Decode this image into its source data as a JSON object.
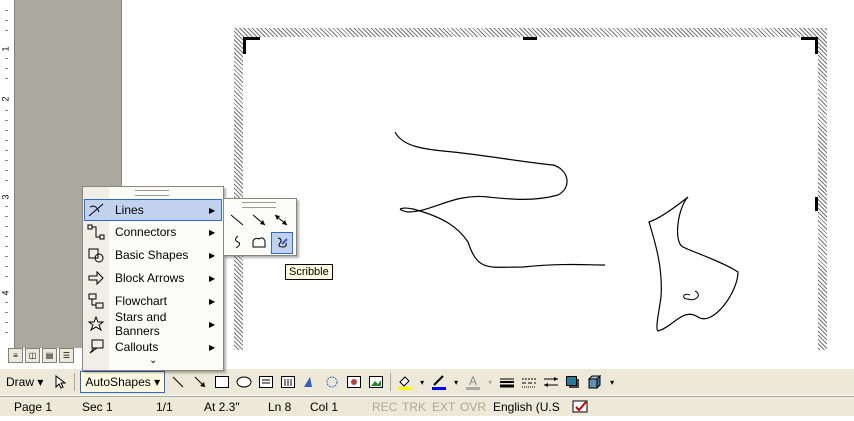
{
  "ruler": {
    "numbers": [
      "1",
      "2",
      "3",
      "4"
    ]
  },
  "draw_toolbar": {
    "draw_label": "Draw",
    "autoshapes_label": "AutoShapes",
    "icons": [
      "select-pointer-icon",
      "line-icon",
      "arrow-icon",
      "rectangle-icon",
      "oval-icon",
      "text-box-icon",
      "vertical-text-box-icon",
      "wordart-icon",
      "diagram-icon",
      "clip-art-icon",
      "picture-icon",
      "fill-color-icon",
      "line-color-icon",
      "font-color-icon",
      "line-style-icon",
      "dash-style-icon",
      "arrow-style-icon",
      "shadow-style-icon",
      "3d-style-icon"
    ],
    "accent_fill": "#ffff00",
    "accent_line": "#0000ff",
    "accent_font": "#ff0000"
  },
  "autoshapes_menu": {
    "items": [
      {
        "label": "Lines",
        "icon": "lines-icon",
        "highlighted": true
      },
      {
        "label": "Connectors",
        "icon": "connectors-icon"
      },
      {
        "label": "Basic Shapes",
        "icon": "basic-shapes-icon"
      },
      {
        "label": "Block Arrows",
        "icon": "block-arrows-icon"
      },
      {
        "label": "Flowchart",
        "icon": "flowchart-icon"
      },
      {
        "label": "Stars and Banners",
        "icon": "stars-banners-icon"
      },
      {
        "label": "Callouts",
        "icon": "callouts-icon"
      }
    ]
  },
  "lines_submenu": {
    "tools": [
      "line-tool-icon",
      "arrow-tool-icon",
      "double-arrow-tool-icon",
      "curve-tool-icon",
      "freeform-tool-icon",
      "scribble-tool-icon"
    ],
    "selected": "scribble-tool-icon"
  },
  "tooltip": "Scribble",
  "status": {
    "page": "Page 1",
    "sec": "Sec 1",
    "pages": "1/1",
    "at": "At 2.3\"",
    "ln": "Ln 8",
    "col": "Col 1",
    "rec": "REC",
    "trk": "TRK",
    "ext": "EXT",
    "ovr": "OVR",
    "language": "English (U.S"
  }
}
